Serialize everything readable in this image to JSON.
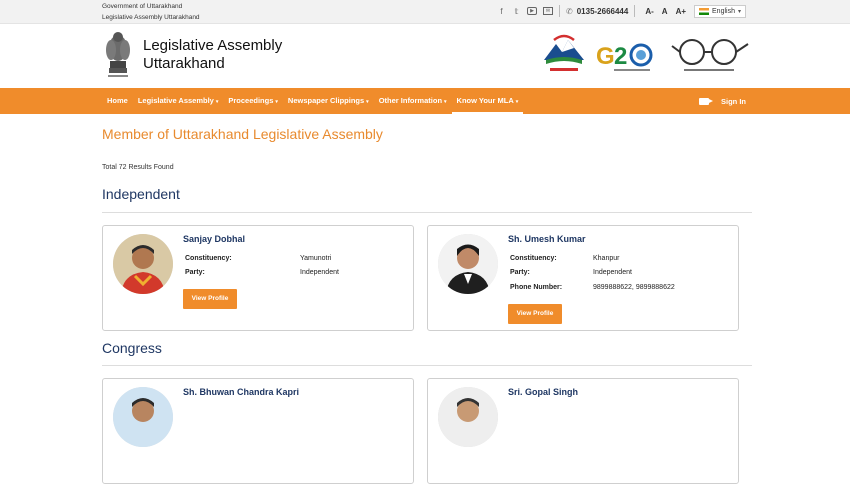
{
  "topbar": {
    "gov_line1": "Government of Uttarakhand",
    "gov_line2": "Legislative Assembly Uttarakhand",
    "phone": "0135-2666444",
    "font_decrease": "A-",
    "font_normal": "A",
    "font_increase": "A+",
    "language": "English"
  },
  "header": {
    "title_line1": "Legislative Assembly",
    "title_line2": "Uttarakhand"
  },
  "nav": {
    "items": [
      {
        "label": "Home",
        "dropdown": false
      },
      {
        "label": "Legislative Assembly",
        "dropdown": true
      },
      {
        "label": "Proceedings",
        "dropdown": true
      },
      {
        "label": "Newspaper Clippings",
        "dropdown": true
      },
      {
        "label": "Other Information",
        "dropdown": true
      },
      {
        "label": "Know Your MLA",
        "dropdown": true
      }
    ],
    "active": "Know Your MLA",
    "sign_in": "Sign In",
    "caret": "▾"
  },
  "main": {
    "heading": "Member of Uttarakhand Legislative Assembly",
    "results": "Total 72 Results Found",
    "sections": [
      {
        "title": "Independent",
        "members": [
          {
            "name": "Sanjay Dobhal",
            "fields": [
              {
                "label": "Constituency:",
                "value": "Yamunotri"
              },
              {
                "label": "Party:",
                "value": "Independent"
              }
            ],
            "button": "View Profile"
          },
          {
            "name": "Sh. Umesh Kumar",
            "fields": [
              {
                "label": "Constituency:",
                "value": "Khanpur"
              },
              {
                "label": "Party:",
                "value": "Independent"
              },
              {
                "label": "Phone Number:",
                "value": "9899888622, 9899888622"
              }
            ],
            "button": "View Profile"
          }
        ]
      },
      {
        "title": "Congress",
        "members": [
          {
            "name": "Sh. Bhuwan Chandra Kapri"
          },
          {
            "name": "Sri. Gopal Singh"
          }
        ]
      }
    ]
  },
  "colors": {
    "accent": "#f08c2b",
    "heading": "#e88a2e",
    "navy": "#1f3763"
  }
}
